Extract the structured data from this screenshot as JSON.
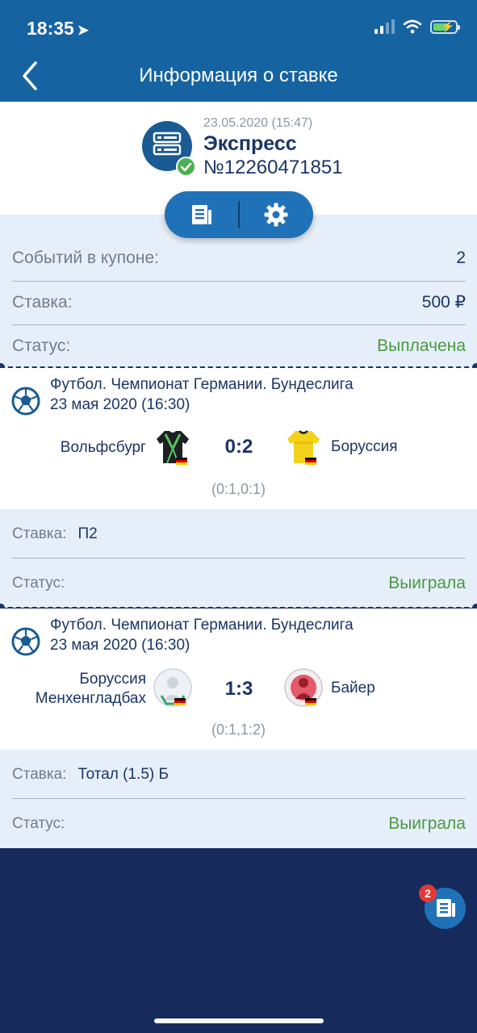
{
  "status_bar": {
    "time": "18:35",
    "location_glyph": "➤"
  },
  "nav": {
    "title": "Информация о ставке"
  },
  "bet": {
    "date": "23.05.2020 (15:47)",
    "type": "Экспресс",
    "number": "№12260471851"
  },
  "summary": {
    "events_label": "Событий в купоне:",
    "events_value": "2",
    "stake_label": "Ставка:",
    "stake_value": "500 ₽",
    "status_label": "Статус:",
    "status_value": "Выплачена"
  },
  "events": [
    {
      "league": "Футбол. Чемпионат Германии. Бундеслига",
      "date": "23 мая 2020 (16:30)",
      "home": "Вольфсбург",
      "away": "Боруссия",
      "score": "0:2",
      "halves": "(0:1,0:1)",
      "pick_label": "Ставка:",
      "pick": "П2",
      "status_label": "Статус:",
      "status": "Выиграла"
    },
    {
      "league": "Футбол. Чемпионат Германии. Бундеслига",
      "date": "23 мая 2020 (16:30)",
      "home_line1": "Боруссия",
      "home_line2": "Менхенгладбах",
      "away": "Байер",
      "score": "1:3",
      "halves": "(0:1,1:2)",
      "pick_label": "Ставка:",
      "pick": "Тотал (1.5) Б",
      "status_label": "Статус:",
      "status": "Выиграла"
    }
  ],
  "fab": {
    "badge": "2",
    "icon": "coupon-icon"
  },
  "colors": {
    "header": "#1663a2",
    "accent_green": "#4a9a40",
    "text_dark": "#1a3566",
    "page_bg": "#162a5c"
  }
}
